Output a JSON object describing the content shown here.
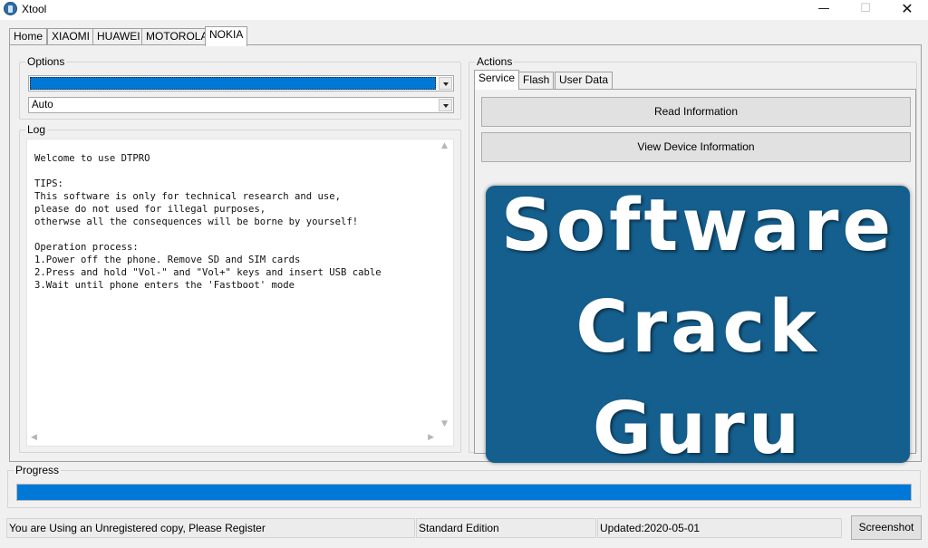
{
  "window": {
    "title": "Xtool",
    "minimize_glyph": "—",
    "maximize_glyph": "☐",
    "close_glyph": "✕"
  },
  "tabs": [
    {
      "label": "Home"
    },
    {
      "label": "XIAOMI"
    },
    {
      "label": "HUAWEI"
    },
    {
      "label": "MOTOROLA"
    },
    {
      "label": "NOKIA"
    }
  ],
  "active_tab": "NOKIA",
  "options": {
    "legend": "Options",
    "combo1_value": "",
    "combo2_value": "Auto"
  },
  "log": {
    "legend": "Log",
    "text": "Welcome to use DTPRO\n\nTIPS:\nThis software is only for technical research and use,\nplease do not used for illegal purposes,\notherwse all the consequences will be borne by yourself!\n\nOperation process:\n1.Power off the phone. Remove SD and SIM cards\n2.Press and hold \"Vol-\" and \"Vol+\" keys and insert USB cable\n3.Wait until phone enters the 'Fastboot' mode"
  },
  "actions": {
    "legend": "Actions",
    "tabs": [
      {
        "label": "Service"
      },
      {
        "label": "Flash"
      },
      {
        "label": "User Data"
      }
    ],
    "active_tab": "Service",
    "read_info_label": "Read Information",
    "view_device_label": "View Device Information",
    "watermark_lines": [
      "Software",
      "Crack",
      "Guru"
    ]
  },
  "progress": {
    "legend": "Progress",
    "value_percent": 100
  },
  "status": {
    "registration": "You are Using an Unregistered copy, Please Register",
    "edition": "Standard Edition",
    "updated": "Updated:2020-05-01"
  },
  "screenshot_label": "Screenshot",
  "colors": {
    "accent_blue": "#0078d7",
    "logo_bg": "#155f8e"
  },
  "icons": {
    "app": "app-icon",
    "dropdown": "chevron-down-icon",
    "scroll_up": "scroll-up-arrow-icon",
    "scroll_down": "scroll-down-arrow-icon",
    "scroll_left": "scroll-left-arrow-icon",
    "scroll_right": "scroll-right-arrow-icon"
  }
}
